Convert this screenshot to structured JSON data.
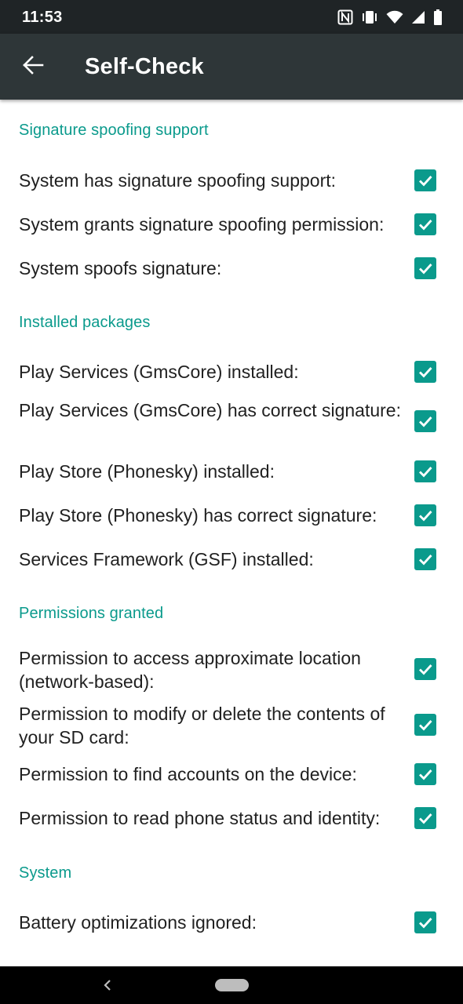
{
  "status_bar": {
    "time": "11:53",
    "icons": [
      "nfc-icon",
      "vibrate-icon",
      "wifi-icon",
      "signal-icon",
      "battery-icon"
    ]
  },
  "app_bar": {
    "back_icon": "arrow-back-icon",
    "title": "Self-Check"
  },
  "colors": {
    "accent": "#0a9a8c",
    "status_bar": "#1f2426",
    "app_bar": "#2e3638",
    "text": "#212121",
    "nav_bar": "#000000"
  },
  "sections": [
    {
      "header": "Signature spoofing support",
      "items": [
        {
          "label": "System has signature spoofing support:",
          "checked": true
        },
        {
          "label": "System grants signature spoofing permission:",
          "checked": true
        },
        {
          "label": "System spoofs signature:",
          "checked": true
        }
      ]
    },
    {
      "header": "Installed packages",
      "items": [
        {
          "label": "Play Services (GmsCore) installed:",
          "checked": true
        },
        {
          "label": "Play Services (GmsCore) has correct signature:",
          "checked": true
        },
        {
          "label": "Play Store (Phonesky) installed:",
          "checked": true
        },
        {
          "label": "Play Store (Phonesky) has correct signature:",
          "checked": true
        },
        {
          "label": "Services Framework (GSF) installed:",
          "checked": true
        }
      ]
    },
    {
      "header": "Permissions granted",
      "items": [
        {
          "label": "Permission to access approximate location (network-based):",
          "checked": true
        },
        {
          "label": "Permission to modify or delete the contents of your SD card:",
          "checked": true
        },
        {
          "label": "Permission to find accounts on the device:",
          "checked": true
        },
        {
          "label": "Permission to read phone status and identity:",
          "checked": true
        }
      ]
    },
    {
      "header": "System",
      "items": [
        {
          "label": "Battery optimizations ignored:",
          "checked": true
        }
      ]
    }
  ],
  "nav_bar": {
    "back_icon": "nav-back-icon",
    "home_icon": "nav-home-pill-icon"
  }
}
